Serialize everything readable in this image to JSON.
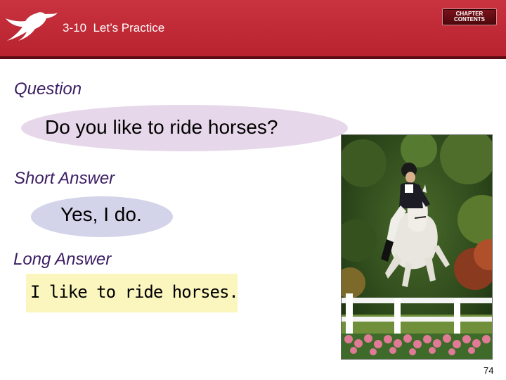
{
  "header": {
    "title": "3-10  Let’s Practice",
    "chapter_button": {
      "line1": "CHAPTER",
      "line2": "CONTENTS"
    },
    "colors": {
      "band": "#b8222f",
      "rule": "#5a0c12"
    },
    "logo_icon": "swallow-bird-icon"
  },
  "question": {
    "label": "Question",
    "text": "Do you like to ride horses?"
  },
  "short_answer": {
    "label": "Short Answer",
    "text": "Yes, I do."
  },
  "long_answer": {
    "label": "Long Answer",
    "text": "I like to ride horses."
  },
  "photo": {
    "subject": "horse-jumping-photo"
  },
  "footer": {
    "page_number": "74"
  }
}
